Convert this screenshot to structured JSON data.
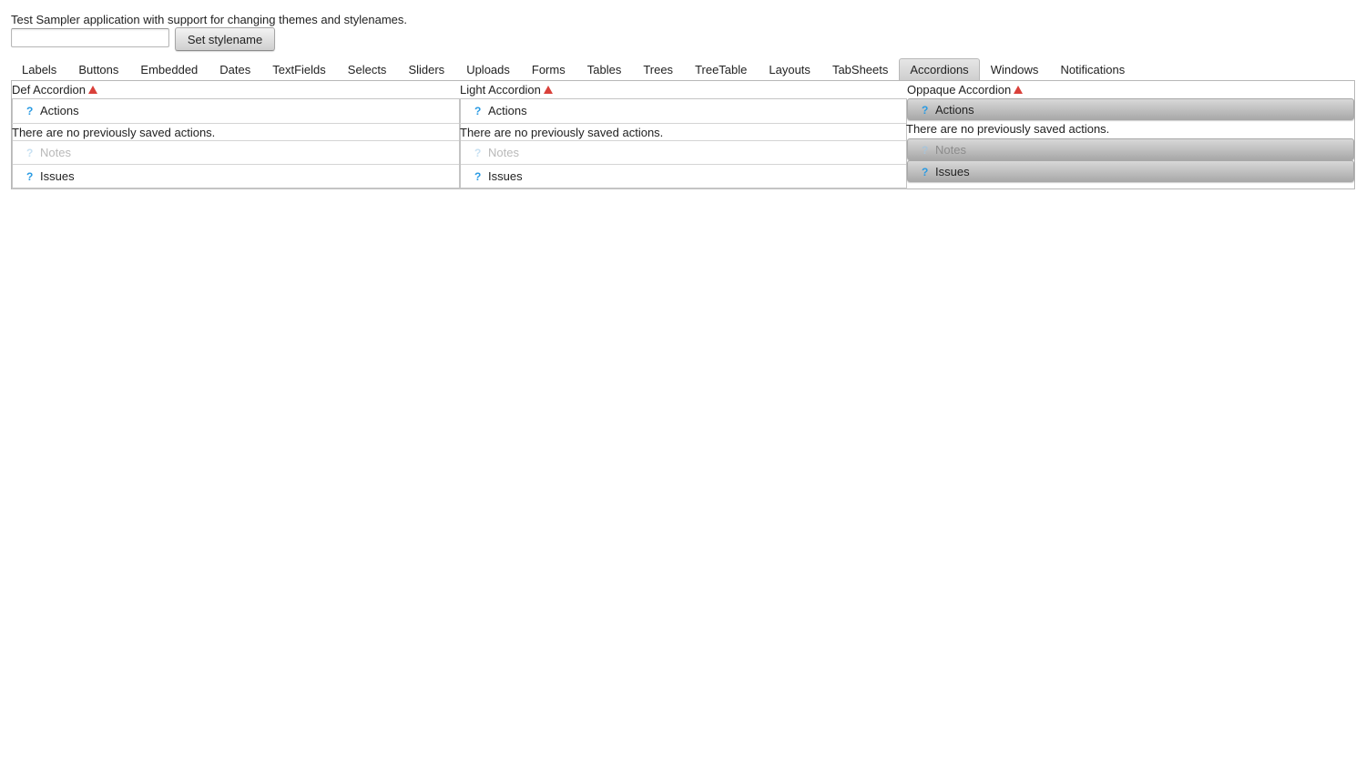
{
  "description": "Test Sampler application with support for changing themes and stylenames.",
  "stylename": {
    "value": "",
    "placeholder": "",
    "button_label": "Set stylename"
  },
  "tabs": [
    {
      "label": "Labels",
      "selected": false
    },
    {
      "label": "Buttons",
      "selected": false
    },
    {
      "label": "Embedded",
      "selected": false
    },
    {
      "label": "Dates",
      "selected": false
    },
    {
      "label": "TextFields",
      "selected": false
    },
    {
      "label": "Selects",
      "selected": false
    },
    {
      "label": "Sliders",
      "selected": false
    },
    {
      "label": "Uploads",
      "selected": false
    },
    {
      "label": "Forms",
      "selected": false
    },
    {
      "label": "Tables",
      "selected": false
    },
    {
      "label": "Trees",
      "selected": false
    },
    {
      "label": "TreeTable",
      "selected": false
    },
    {
      "label": "Layouts",
      "selected": false
    },
    {
      "label": "TabSheets",
      "selected": false
    },
    {
      "label": "Accordions",
      "selected": true
    },
    {
      "label": "Windows",
      "selected": false
    },
    {
      "label": "Notifications",
      "selected": false
    }
  ],
  "accordions": [
    {
      "title": "Def Accordion",
      "items": [
        {
          "caption": "Actions",
          "content": "There are no previously saved actions.",
          "disabled": false
        },
        {
          "caption": "Notes",
          "disabled": true
        },
        {
          "caption": "Issues",
          "disabled": false
        }
      ]
    },
    {
      "title": "Light Accordion",
      "items": [
        {
          "caption": "Actions",
          "content": "There are no previously saved actions.",
          "disabled": false
        },
        {
          "caption": "Notes",
          "disabled": true
        },
        {
          "caption": "Issues",
          "disabled": false
        }
      ]
    },
    {
      "title": "Oppaque Accordion",
      "items": [
        {
          "caption": "Actions",
          "content": "There are no previously saved actions.",
          "disabled": false
        },
        {
          "caption": "Notes",
          "disabled": true
        },
        {
          "caption": "Issues",
          "disabled": false
        }
      ]
    }
  ],
  "icons": {
    "caption_icon": "help-icon",
    "title_icon": "warning-icon",
    "help_glyph": "?"
  },
  "colors": {
    "help_icon": "#2a9be3",
    "warning": "#d9403a",
    "selected_tab": "#d4d4d4"
  }
}
